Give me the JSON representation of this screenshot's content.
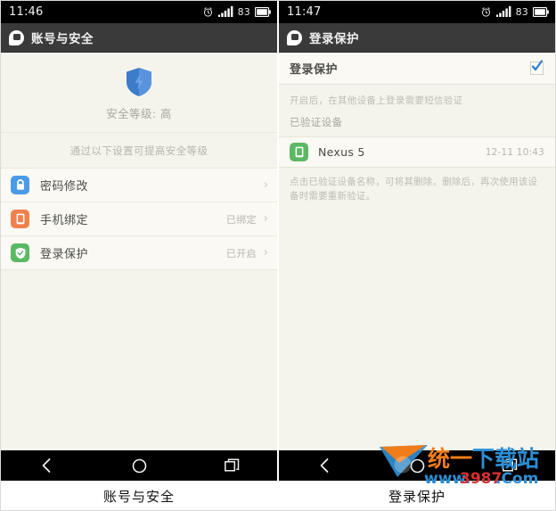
{
  "left": {
    "status": {
      "time": "11:46",
      "alarm_icon": "alarm-clock-icon",
      "signal_icon": "signal-bars-icon",
      "battery_level": "83",
      "battery_icon": "battery-icon"
    },
    "titlebar": {
      "app_icon": "app-badge-icon",
      "title": "账号与安全"
    },
    "hero": {
      "shield_icon": "shield-icon",
      "security_level": "安全等级: 高"
    },
    "hint": "通过以下设置可提高安全等级",
    "list": [
      {
        "icon": "lock-icon",
        "label": "密码修改",
        "value": "",
        "chevron": "›",
        "color": "#4a9ae8"
      },
      {
        "icon": "phone-icon",
        "label": "手机绑定",
        "value": "已绑定",
        "chevron": "›",
        "color": "#f0814d"
      },
      {
        "icon": "shield-icon",
        "label": "登录保护",
        "value": "已开启",
        "chevron": "›",
        "color": "#5cb963"
      }
    ],
    "nav": {
      "back": "back-icon",
      "home": "home-icon",
      "recents": "recents-icon"
    },
    "caption": "账号与安全"
  },
  "right": {
    "status": {
      "time": "11:47",
      "alarm_icon": "alarm-clock-icon",
      "signal_icon": "signal-bars-icon",
      "battery_level": "83",
      "battery_icon": "battery-icon"
    },
    "titlebar": {
      "app_icon": "app-badge-icon",
      "title": "登录保护"
    },
    "toggle": {
      "label": "登录保护",
      "checked": true,
      "check_icon": "checkmark-icon"
    },
    "description": "开启后，在其他设备上登录需要短信验证",
    "section_label": "已验证设备",
    "devices": [
      {
        "icon": "phone-icon",
        "name": "Nexus 5",
        "time": "12-11 10:43",
        "color": "#5cb963"
      }
    ],
    "foot_hint": "点击已验证设备名称，可将其删除。删除后，再次使用该设备时需要重新验证。",
    "nav": {
      "back": "back-icon",
      "home": "home-icon",
      "recents": "recents-icon"
    },
    "caption": "登录保护"
  },
  "watermark": {
    "brand_part1": "统一",
    "brand_part2": "下载站",
    "url_www": "www.",
    "url_num": "3987",
    "url_tld": ".Com",
    "color_orange": "#f07d1a",
    "color_blue": "#2b8fd6",
    "color_red": "#d82f2f"
  }
}
